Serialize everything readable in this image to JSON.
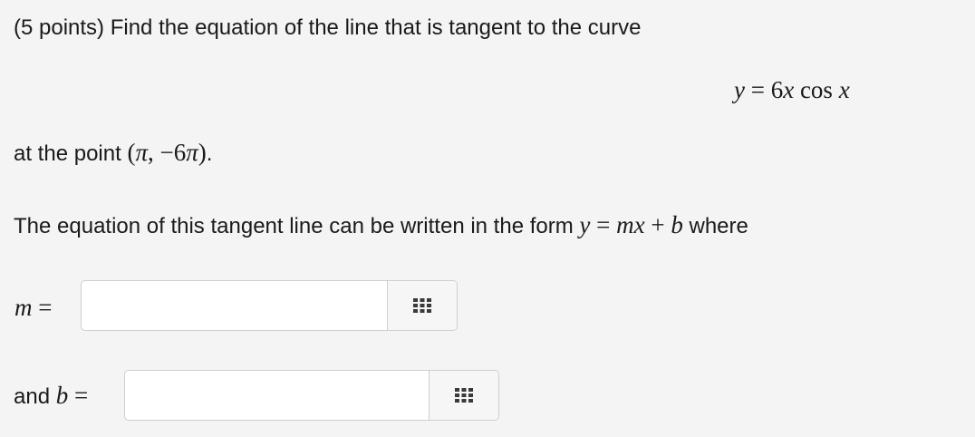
{
  "question": {
    "intro": "(5 points) Find the equation of the line that is tangent to the curve",
    "equation": {
      "lhs": "y",
      "eq": " = ",
      "coef": "6",
      "var1": "x",
      "func": " cos ",
      "var2": "x"
    },
    "point_prefix": "at the point ",
    "point": {
      "open": "(",
      "x": "π",
      "sep": ", −6",
      "y": "π",
      "close": ")"
    },
    "point_suffix": ".",
    "form_text": "The equation of this tangent line can be written in the form ",
    "form": {
      "y": "y",
      "eq": " = ",
      "m": "m",
      "x": "x",
      "plus": " + ",
      "b": "b"
    },
    "form_suffix": " where"
  },
  "answers": {
    "m_var": "m",
    "m_eq": " =",
    "m_value": "",
    "b_prefix": "and ",
    "b_var": "b",
    "b_eq": " =",
    "b_value": ""
  },
  "icons": {
    "matrix_button": "grid-icon"
  }
}
